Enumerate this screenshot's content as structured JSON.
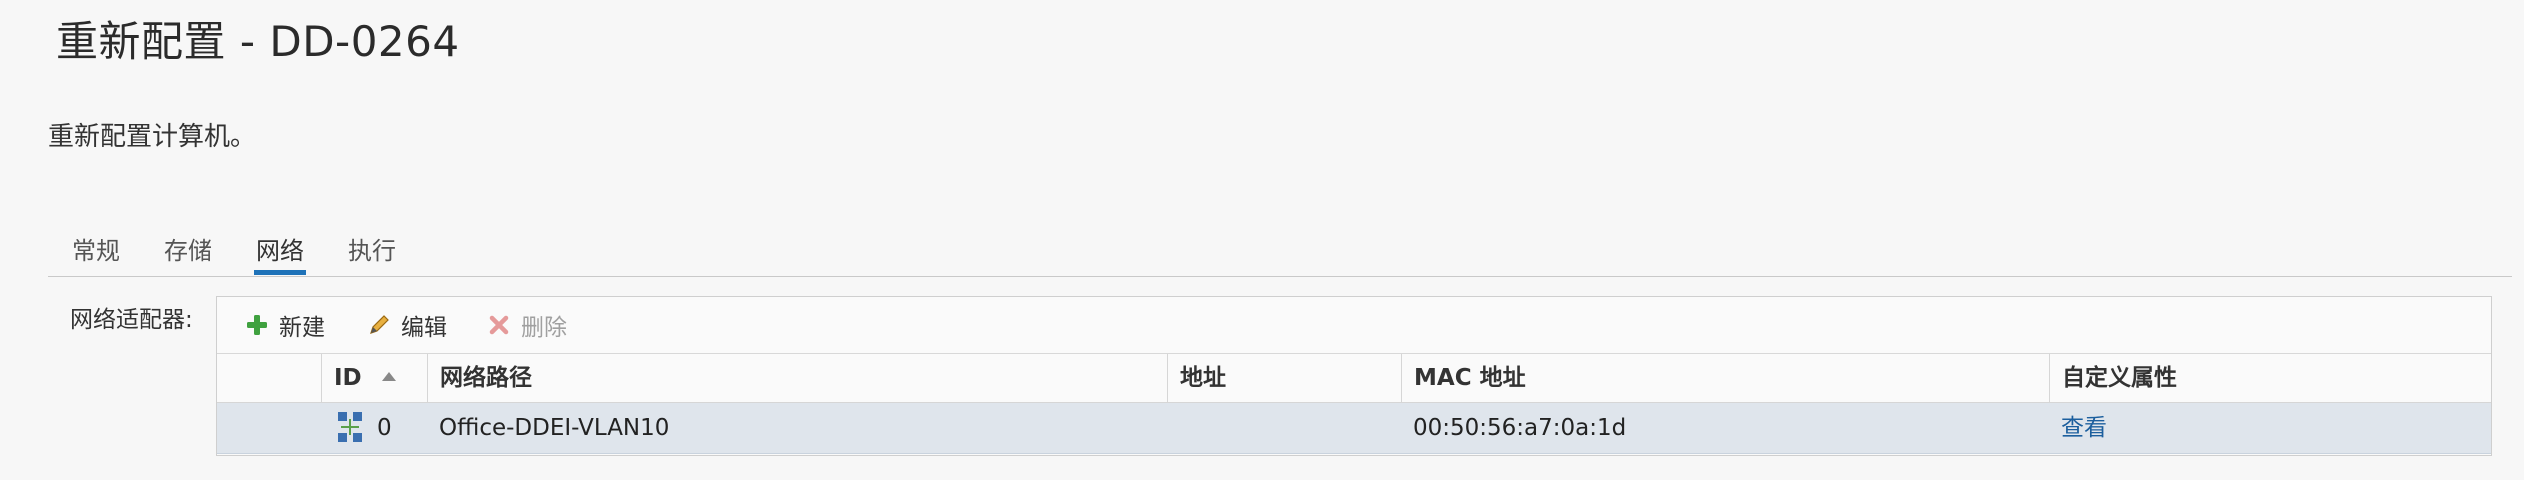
{
  "page": {
    "title": "重新配置 - DD-0264",
    "description": "重新配置计算机。"
  },
  "tabs": [
    {
      "label": "常规",
      "active": false
    },
    {
      "label": "存储",
      "active": false
    },
    {
      "label": "网络",
      "active": true
    },
    {
      "label": "执行",
      "active": false
    }
  ],
  "network": {
    "field_label": "网络适配器:",
    "toolbar": {
      "new_label": "新建",
      "edit_label": "编辑",
      "delete_label": "删除"
    },
    "columns": [
      "ID",
      "网络路径",
      "地址",
      "MAC 地址",
      "自定义属性"
    ],
    "rows": [
      {
        "id": "0",
        "network_path": "Office-DDEI-VLAN10",
        "address": "",
        "mac": "00:50:56:a7:0a:1d",
        "custom_attr": "查看",
        "icon": "network-adapter-icon",
        "selected": true
      }
    ]
  },
  "colors": {
    "accent": "#1e72b8",
    "selected_row": "#dfe5ec",
    "link": "#1c5f9e",
    "add": "#3fa13f",
    "delete_disabled": "#e59a9a"
  }
}
